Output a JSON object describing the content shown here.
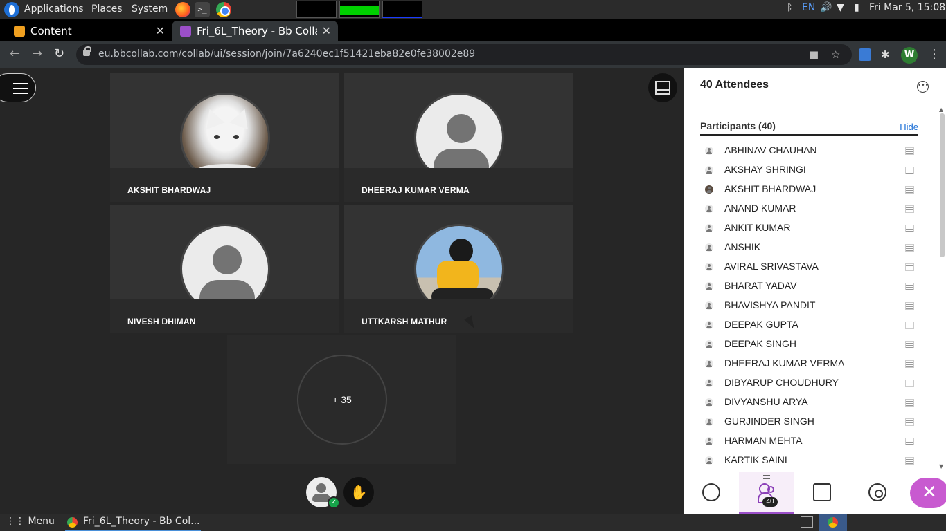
{
  "os_panel": {
    "menus": [
      "Applications",
      "Places",
      "System"
    ],
    "keyboard_layout": "EN",
    "clock": "Fri Mar  5, 15:08"
  },
  "browser": {
    "tabs": [
      {
        "title": "Content"
      },
      {
        "title": "Fri_6L_Theory - Bb Collab"
      }
    ],
    "url": "eu.bbcollab.com/collab/ui/session/join/7a6240ec1f51421eba82e0fe38002e89",
    "profile_initial": "W"
  },
  "stage": {
    "tiles": [
      {
        "name": "AKSHIT BHARDWAJ",
        "avatar": "cat-photo"
      },
      {
        "name": "DHEERAJ KUMAR VERMA",
        "avatar": "default-person"
      },
      {
        "name": "NIVESH DHIMAN",
        "avatar": "default-person"
      },
      {
        "name": "UTTKARSH MATHUR",
        "avatar": "person-photo"
      }
    ],
    "more_count": "+ 35"
  },
  "panel": {
    "title": "40 Attendees",
    "section_title": "Participants (40)",
    "hide_label": "Hide",
    "participants": [
      "ABHINAV CHAUHAN",
      "AKSHAY SHRINGI",
      "AKSHIT BHARDWAJ",
      "ANAND KUMAR",
      "ANKIT KUMAR",
      "ANSHIK",
      "AVIRAL SRIVASTAVA",
      "BHARAT YADAV",
      "BHAVISHYA PANDIT",
      "DEEPAK GUPTA",
      "DEEPAK SINGH",
      "DHEERAJ KUMAR VERMA",
      "DIBYARUP CHOUDHURY",
      "DIVYANSHU ARYA",
      "GURJINDER SINGH",
      "HARMAN MEHTA",
      "KARTIK SAINI"
    ],
    "attendee_badge": "40"
  },
  "taskbar": {
    "menu_label": "Menu",
    "task_title": "Fri_6L_Theory - Bb Col..."
  },
  "colors": {
    "accent": "#9b4fc9",
    "close_button": "#c85ad0",
    "link": "#1b6fd6",
    "success": "#17a34a"
  }
}
